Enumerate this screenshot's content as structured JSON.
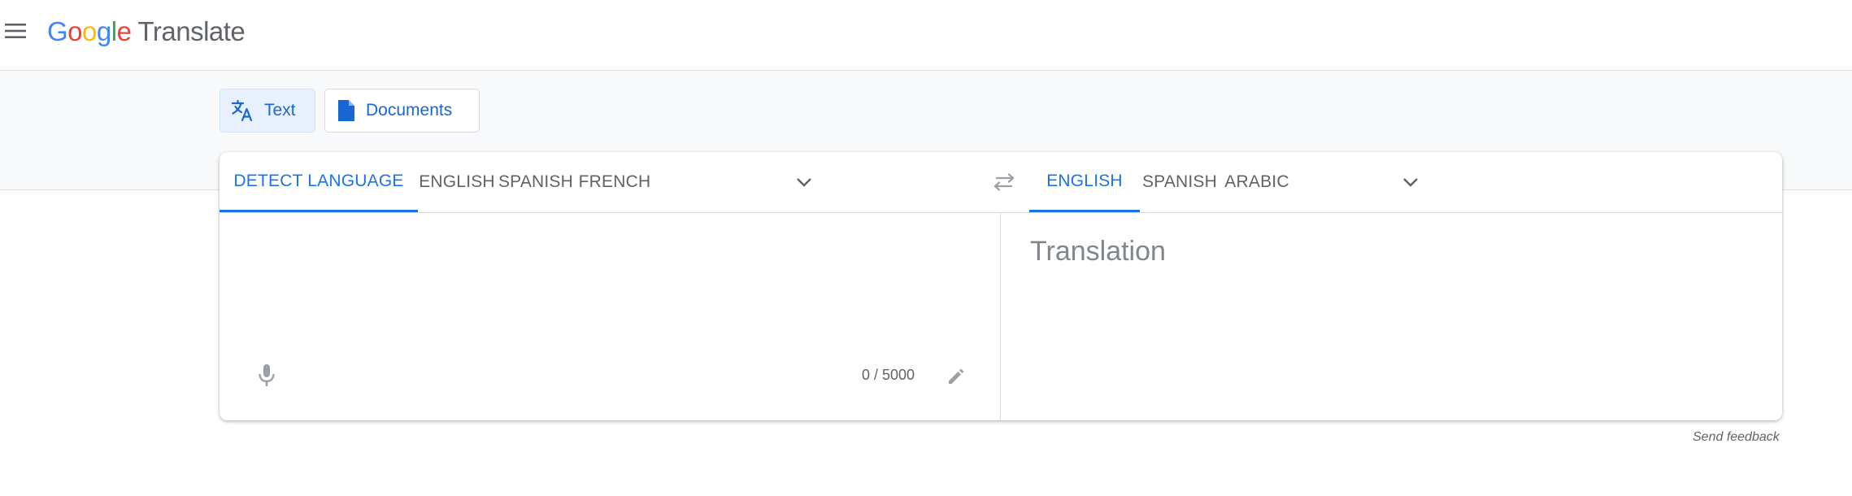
{
  "header": {
    "logo_letters": [
      "G",
      "o",
      "o",
      "g",
      "l",
      "e"
    ],
    "product": "Translate",
    "menu_icon": "hamburger-menu-icon"
  },
  "modes": {
    "text": {
      "label": "Text",
      "icon": "translate-icon",
      "selected": true
    },
    "documents": {
      "label": "Documents",
      "icon": "document-icon",
      "selected": false
    }
  },
  "source": {
    "tabs": [
      "DETECT LANGUAGE",
      "ENGLISH",
      "SPANISH",
      "FRENCH"
    ],
    "active_index": 0,
    "input_value": "",
    "char_count": "0 / 5000"
  },
  "target": {
    "tabs": [
      "ENGLISH",
      "SPANISH",
      "ARABIC"
    ],
    "active_index": 0,
    "placeholder": "Translation"
  },
  "footer": {
    "feedback": "Send feedback"
  },
  "colors": {
    "accent": "#1a73e8",
    "mode_active_bg": "#e8f0fe",
    "band_bg": "#f8f9fa",
    "logo_blue": "#4285f4",
    "logo_red": "#ea4335",
    "logo_yellow": "#fbbc05",
    "logo_green": "#34a853"
  }
}
